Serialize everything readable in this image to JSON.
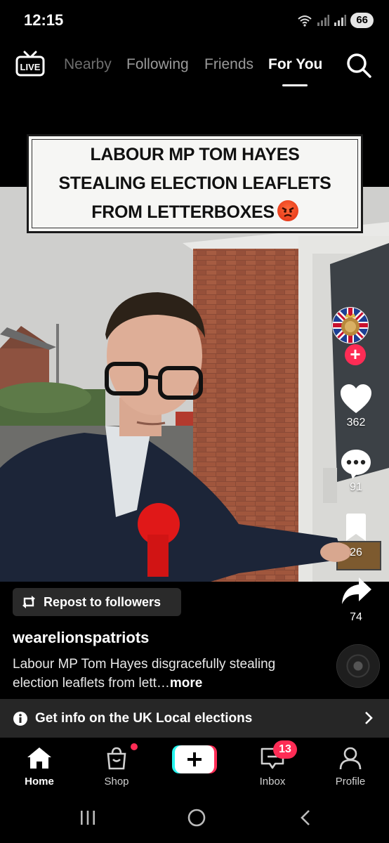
{
  "status_bar": {
    "time": "12:15",
    "battery": "66",
    "signal_icons": [
      "wifi-icon",
      "signal-icon",
      "signal-icon"
    ]
  },
  "top_nav": {
    "live_label": "LIVE",
    "tabs": [
      "Nearby",
      "Following",
      "Friends",
      "For You"
    ],
    "active_tab": "For You"
  },
  "video": {
    "caption_lines": [
      "LABOUR MP TOM HAYES",
      "STEALING ELECTION LEAFLETS",
      "FROM LETTERBOXES"
    ],
    "caption_emoji": "angry-face"
  },
  "rail": {
    "likes": "362",
    "comments": "91",
    "saves": "26",
    "shares": "74"
  },
  "post": {
    "repost_label": "Repost to followers",
    "username": "wearelionspatriots",
    "description": "Labour MP Tom Hayes disgracefully stealing election leaflets from lett…",
    "more": "more"
  },
  "election_banner": {
    "text": "Get info on the UK Local elections"
  },
  "bottom_nav": {
    "home": "Home",
    "shop": "Shop",
    "inbox": "Inbox",
    "inbox_badge": "13",
    "profile": "Profile"
  },
  "colors": {
    "accent": "#fe2c55",
    "teal": "#25f4ee",
    "banner_bg": "#262626"
  }
}
